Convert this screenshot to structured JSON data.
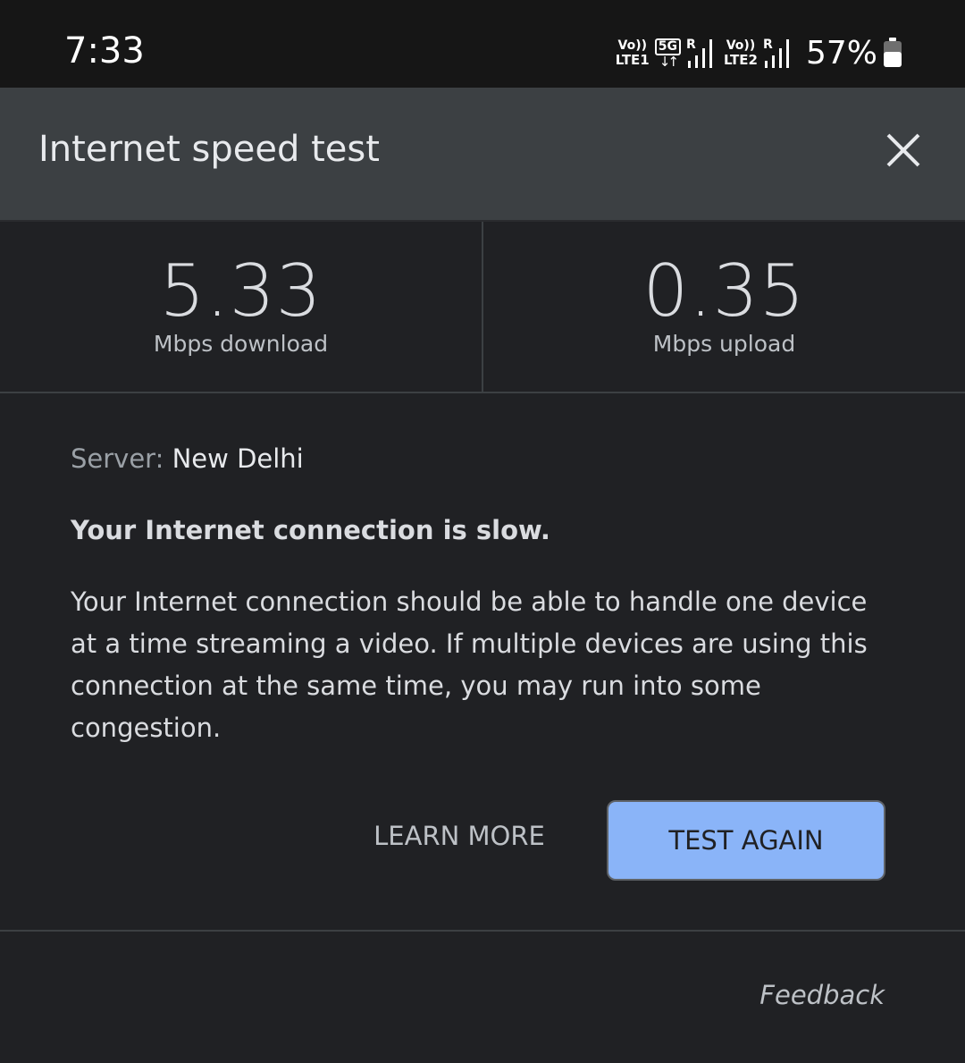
{
  "status_bar": {
    "time": "7:33",
    "sim1_volte": "Vo))",
    "sim1_network": "LTE1",
    "sim2_volte": "Vo))",
    "sim2_network": "LTE2",
    "data_type": "5G",
    "roaming_indicator": "R",
    "battery_percent": "57%",
    "battery_level": 0.57,
    "icons": [
      "signal-icon",
      "battery-icon",
      "data-arrows-icon"
    ]
  },
  "header": {
    "title": "Internet speed test",
    "close_icon": "close-icon"
  },
  "results": {
    "download_value": "5.33",
    "download_label": "Mbps download",
    "upload_value": "0.35",
    "upload_label": "Mbps upload"
  },
  "info": {
    "server_label": "Server:",
    "server_name": "New Delhi",
    "verdict": "Your Internet connection is slow.",
    "description": "Your Internet connection should be able to handle one device at a time streaming a video. If multiple devices are using this connection at the same time, you may run into some congestion."
  },
  "actions": {
    "learn_more": "LEARN MORE",
    "test_again": "TEST AGAIN",
    "feedback": "Feedback"
  },
  "colors": {
    "background": "#202124",
    "header": "#3c4043",
    "accent": "#8ab4f8",
    "status_bar": "#161616"
  }
}
